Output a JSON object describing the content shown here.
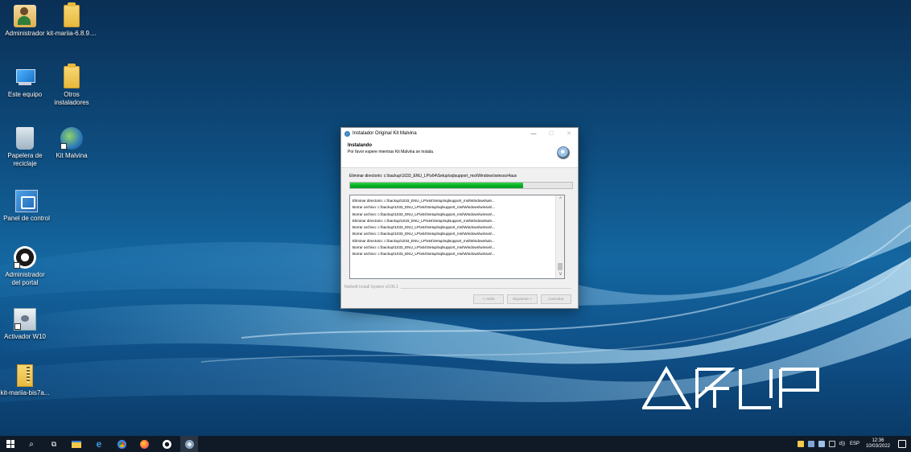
{
  "desktop": {
    "icons": [
      {
        "label": "Administrador",
        "icon": "user-folder-icon"
      },
      {
        "label": "kit-mariia-6.8.9....",
        "icon": "folder-icon"
      },
      {
        "label": "Este equipo",
        "icon": "computer-icon"
      },
      {
        "label": "Otros instaladores",
        "icon": "folder-icon"
      },
      {
        "label": "Papelera de reciclaje",
        "icon": "recycle-bin-icon"
      },
      {
        "label": "Kit Malvina",
        "icon": "globe-icon"
      },
      {
        "label": "Panel de control",
        "icon": "control-panel-icon"
      },
      {
        "label": "Administrador del portal",
        "icon": "portal-icon"
      },
      {
        "label": "Activador W10",
        "icon": "activator-icon"
      },
      {
        "label": "kit-mariia-bis7a...",
        "icon": "zip-folder-icon"
      }
    ],
    "colors": {
      "accent": "#1467a1"
    }
  },
  "dialog": {
    "title": "Instalador Original Kit Malvina",
    "buttons_title": {
      "minimize": "—",
      "maximize": "☐",
      "close": "✕"
    },
    "header_title": "Instalando",
    "header_subtitle": "Por favor espere mientras Kit Malvina se instala.",
    "status": "Eliminar directorio: c:\\backup\\1033_ENU_LP\\x64\\Setup\\sqlsupport_msi\\Windows\\winsxs\\4aux",
    "progress": 0.78,
    "log": [
      "Eliminar directorio: c:\\backup\\1033_ENU_LP\\x64\\Setup\\sqlsupport_msi\\Windows\\win...",
      "Borrar archivo: c:\\backup\\1033_ENU_LP\\x64\\Setup\\sqlsupport_msi\\Windows\\winsxs\\...",
      "Borrar archivo: c:\\backup\\1033_ENU_LP\\x64\\Setup\\sqlsupport_msi\\Windows\\winsxs\\...",
      "Eliminar directorio: c:\\backup\\1033_ENU_LP\\x64\\Setup\\sqlsupport_msi\\Windows\\win...",
      "Borrar archivo: c:\\backup\\1033_ENU_LP\\x64\\Setup\\sqlsupport_msi\\Windows\\winsxs\\...",
      "Borrar archivo: c:\\backup\\1033_ENU_LP\\x64\\Setup\\sqlsupport_msi\\Windows\\winsxs\\...",
      "Eliminar directorio: c:\\backup\\1033_ENU_LP\\x64\\Setup\\sqlsupport_msi\\Windows\\win...",
      "Borrar archivo: c:\\backup\\1033_ENU_LP\\x64\\Setup\\sqlsupport_msi\\Windows\\winsxs\\...",
      "Borrar archivo: c:\\backup\\1033_ENU_LP\\x64\\Setup\\sqlsupport_msi\\Windows\\winsxs\\..."
    ],
    "branding": "Nullsoft Install System v3.06.1",
    "back_label": "< Atrás",
    "next_label": "Siguiente >",
    "cancel_label": "Cancelar",
    "colors": {
      "progress": "#06b025"
    }
  },
  "taskbar": {
    "apps": [
      "start-icon",
      "search-icon",
      "task-view-icon",
      "file-explorer-icon",
      "edge-icon",
      "chrome-icon",
      "firefox-icon",
      "opera-icon",
      "installer-icon"
    ],
    "tray": {
      "language": "ESP",
      "volume": "d))",
      "time": "12:36",
      "date": "10/03/2022"
    }
  }
}
